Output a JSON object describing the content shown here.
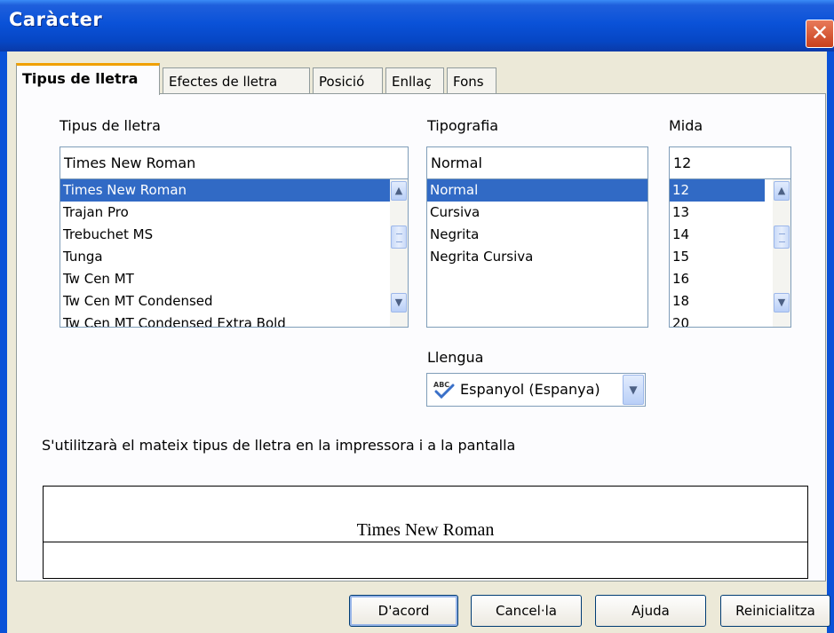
{
  "window": {
    "title": "Caràcter",
    "close_glyph": "✕"
  },
  "tabs": [
    {
      "label": "Tipus de lletra",
      "active": true
    },
    {
      "label": "Efectes de lletra",
      "active": false
    },
    {
      "label": "Posició",
      "active": false
    },
    {
      "label": "Enllaç",
      "active": false
    },
    {
      "label": "Fons",
      "active": false
    }
  ],
  "font": {
    "label": "Tipus de lletra",
    "value": "Times New Roman",
    "items": [
      "Times New Roman",
      "Trajan Pro",
      "Trebuchet MS",
      "Tunga",
      "Tw Cen MT",
      "Tw Cen MT Condensed",
      "Tw Cen MT Condensed Extra Bold"
    ],
    "selected_index": 0
  },
  "style": {
    "label": "Tipografia",
    "value": "Normal",
    "items": [
      "Normal",
      "Cursiva",
      "Negrita",
      "Negrita Cursiva"
    ],
    "selected_index": 0
  },
  "size": {
    "label": "Mida",
    "value": "12",
    "items": [
      "12",
      "13",
      "14",
      "15",
      "16",
      "18",
      "20"
    ],
    "selected_index": 0
  },
  "language": {
    "label": "Llengua",
    "value": "Espanyol (Espanya)",
    "icon": "spellcheck-abc-icon"
  },
  "info_text": "S'utilitzarà el mateix tipus de lletra en la impressora i a la pantalla",
  "preview": {
    "text": "Times New Roman"
  },
  "buttons": {
    "ok": "D'acord",
    "cancel": "Cancel·la",
    "help": "Ajuda",
    "reset": "Reinicialitza"
  },
  "colors": {
    "title_bar": "#0a52d8",
    "selection": "#316ac5",
    "tab_accent": "#f0a000",
    "close": "#c8401c"
  }
}
